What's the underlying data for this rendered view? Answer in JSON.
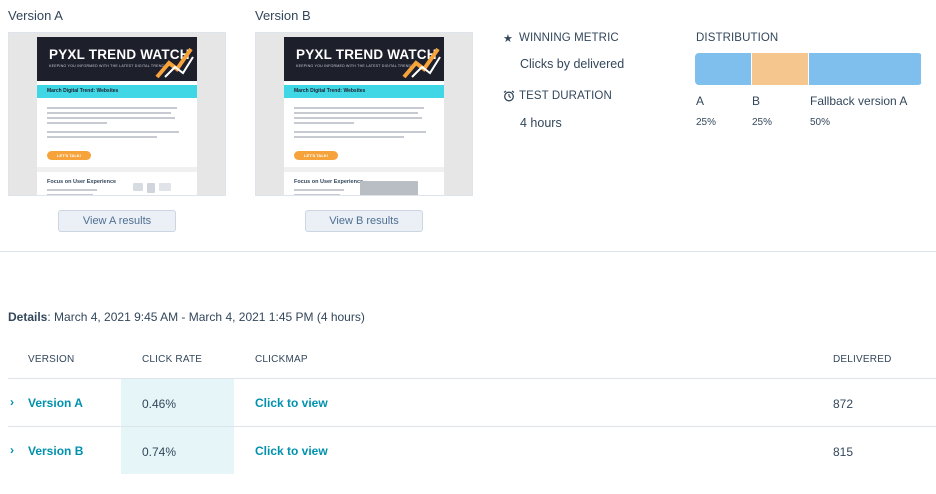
{
  "versions": [
    {
      "title": "Version A",
      "button": "View A results",
      "email": {
        "logo": "PYXL TREND WATCH",
        "tagline": "KEEPING YOU INFORMED WITH THE LATEST DIGITAL TRENDS",
        "band": "March Digital Trend: Websites",
        "cta": "LET'S TALK!",
        "section": "Focus on User Experience"
      }
    },
    {
      "title": "Version B",
      "button": "View B results",
      "email": {
        "logo": "PYXL TREND WATCH",
        "tagline": "KEEPING YOU INFORMED WITH THE LATEST DIGITAL TRENDS",
        "band": "March Digital Trend: Websites",
        "cta": "LET'S TALK!",
        "section": "Focus on User Experience"
      }
    }
  ],
  "metric": {
    "winning_label": "WINNING METRIC",
    "winning_value": "Clicks by delivered",
    "duration_label": "TEST DURATION",
    "duration_value": "4 hours",
    "star_icon": "star-icon",
    "clock_icon": "alarm-clock-icon"
  },
  "distribution": {
    "label": "DISTRIBUTION",
    "segments": [
      {
        "name": "A",
        "pct": "25%",
        "share": 0.25,
        "color": "#7fbfee"
      },
      {
        "name": "B",
        "pct": "25%",
        "share": 0.25,
        "color": "#f5c78e"
      },
      {
        "name": "Fallback version A",
        "pct": "50%",
        "share": 0.5,
        "color": "#7fbfee"
      }
    ]
  },
  "details": {
    "label": "Details",
    "text": ": March 4, 2021 9:45 AM - March 4, 2021 1:45 PM (4 hours)"
  },
  "table": {
    "headers": [
      "VERSION",
      "CLICK RATE",
      "CLICKMAP",
      "DELIVERED"
    ],
    "rows": [
      {
        "version": "Version A",
        "click_rate": "0.46%",
        "clickmap": "Click to view",
        "delivered": "872"
      },
      {
        "version": "Version B",
        "click_rate": "0.74%",
        "clickmap": "Click to view",
        "delivered": "815"
      }
    ]
  },
  "colors": {
    "link": "#0091ae",
    "text": "#33475b",
    "highlight": "#e5f5f8"
  }
}
